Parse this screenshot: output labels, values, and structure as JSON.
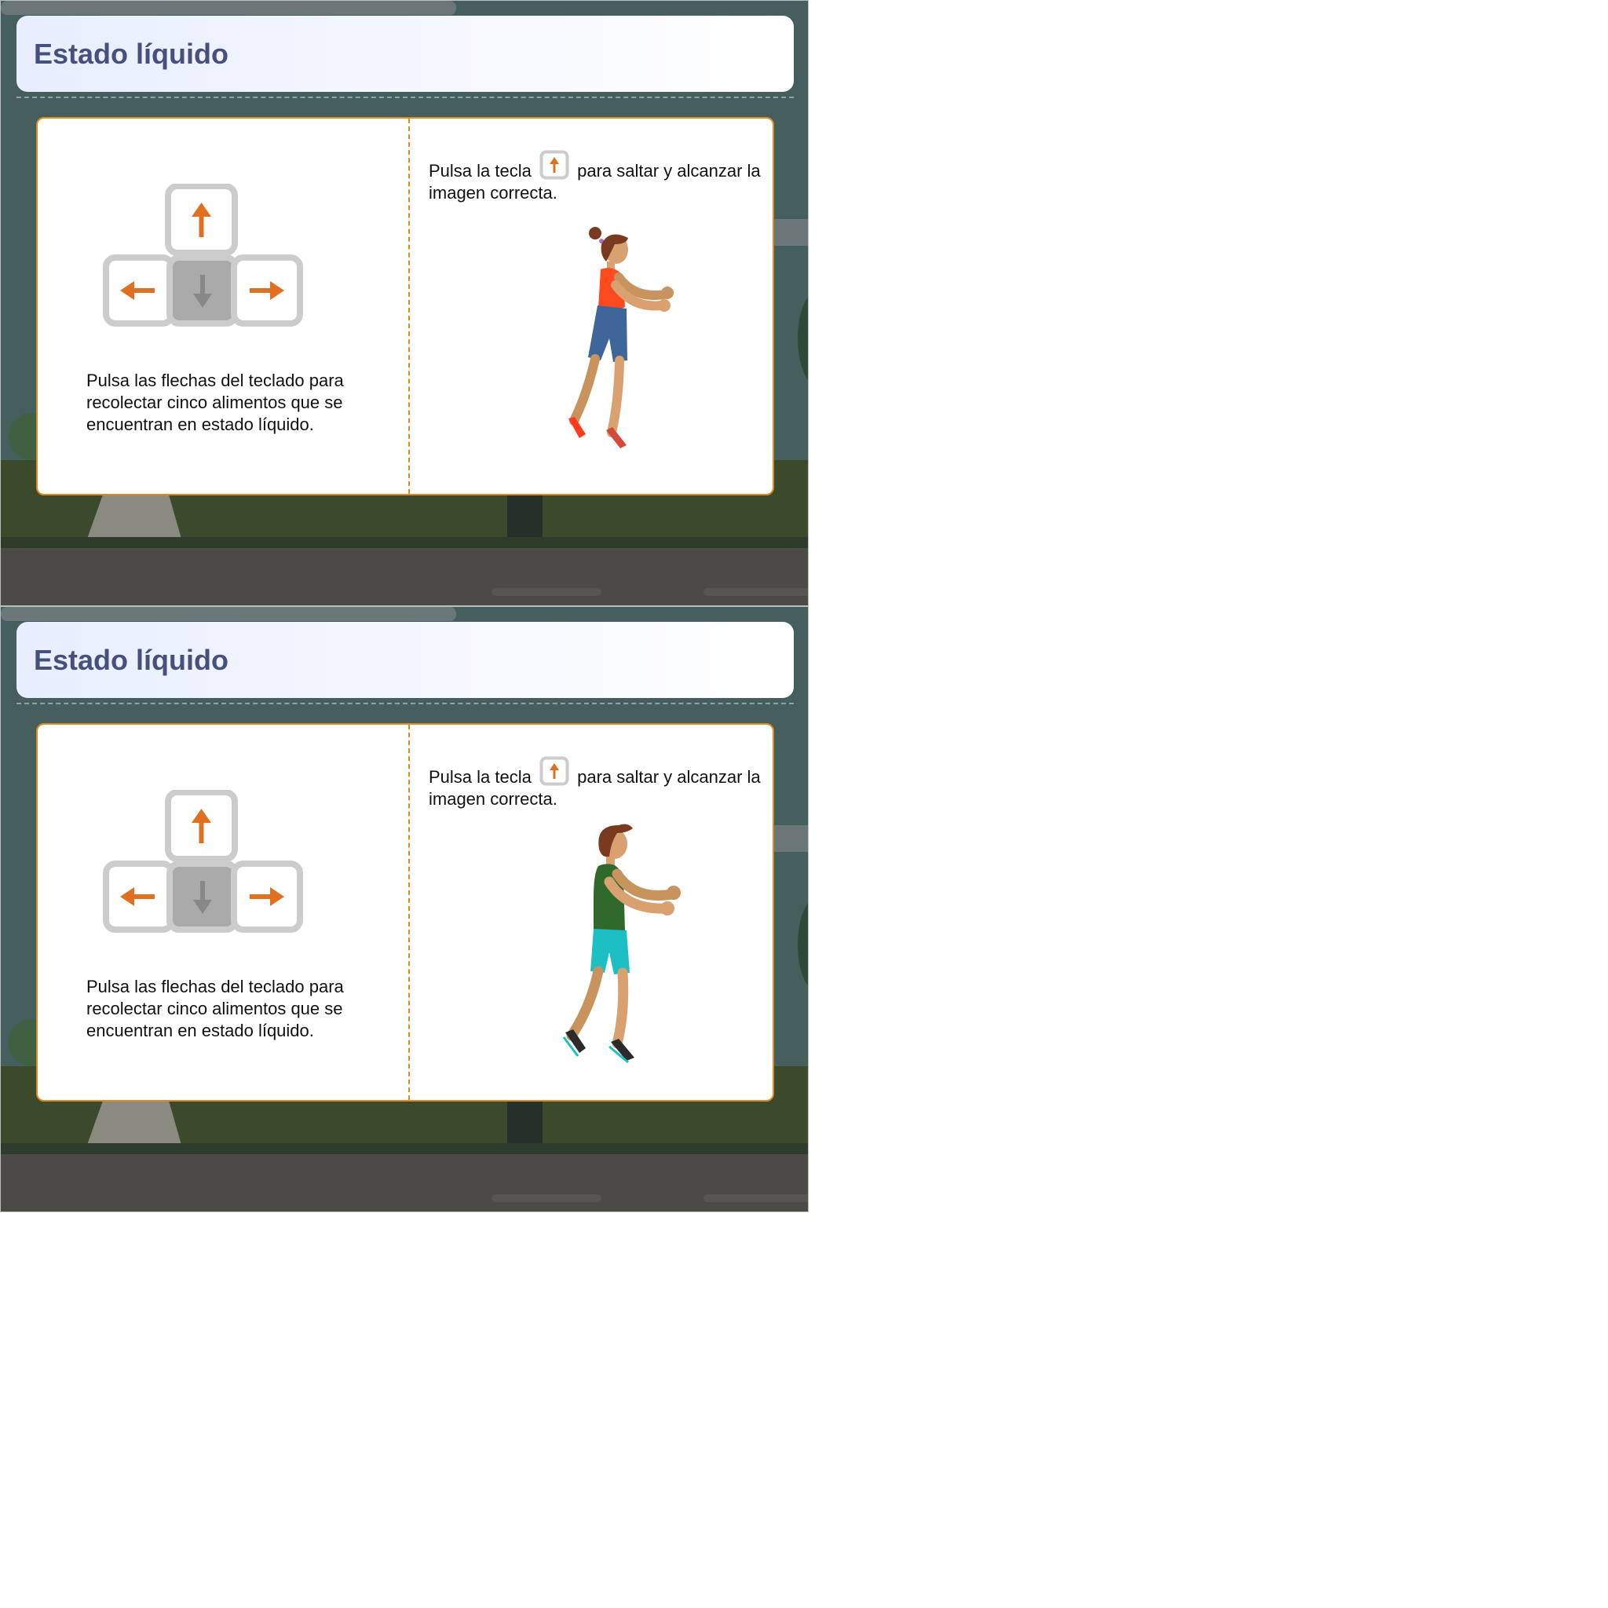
{
  "slides": [
    {
      "title": "Estado líquido",
      "left_text": "Pulsa las flechas del teclado para recolectar cinco alimentos que se encuentran en estado líquido.",
      "right_text_before": "Pulsa la tecla",
      "right_text_after": "para saltar y alcanzar la imagen correcta.",
      "character": "girl-jumping"
    },
    {
      "title": "Estado líquido",
      "left_text": "Pulsa las flechas del teclado para recolectar cinco alimentos que se encuentran en estado líquido.",
      "right_text_before": "Pulsa la tecla",
      "right_text_after": "para saltar y alcanzar la imagen correcta.",
      "character": "boy-jumping"
    }
  ],
  "icons": {
    "up": "arrow-up-icon",
    "down": "arrow-down-icon",
    "left": "arrow-left-icon",
    "right": "arrow-right-icon"
  },
  "colors": {
    "accent": "#e07020",
    "title": "#45507f",
    "card_border": "#e08a1e",
    "background": "#455f5f"
  }
}
